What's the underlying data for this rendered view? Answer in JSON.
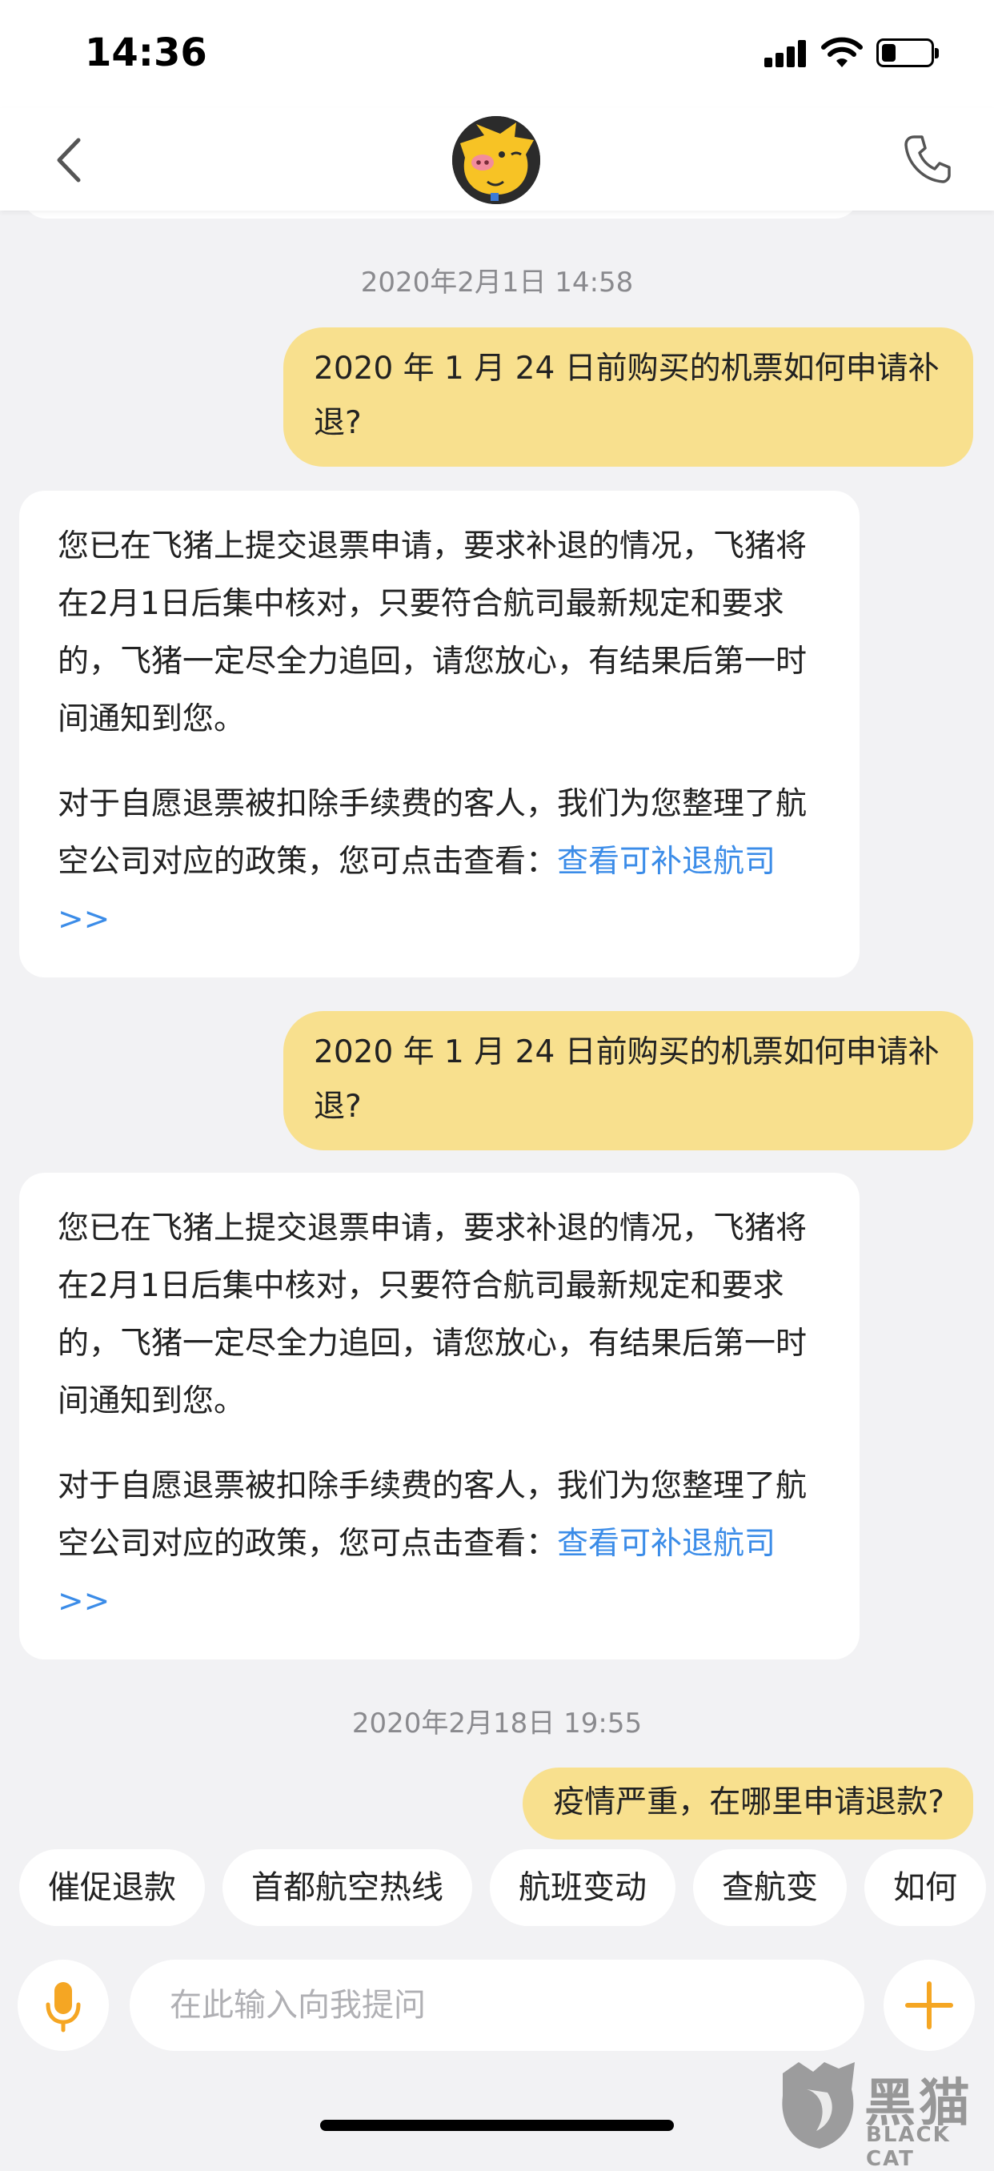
{
  "status_bar": {
    "time": "14:36",
    "battery_level": 0.3
  },
  "nav": {
    "avatar_icon": "fliggy-pig-icon",
    "back_icon": "back-chevron-icon",
    "call_icon": "phone-icon"
  },
  "messages": [
    {
      "type": "timestamp",
      "text": "2020年2月1日 14:58"
    },
    {
      "type": "user",
      "text": "2020 年 1 月 24 日前购买的机票如何申请补退?"
    },
    {
      "type": "bot",
      "p1": "您已在飞猪上提交退票申请，要求补退的情况，飞猪将在2月1日后集中核对，只要符合航司最新规定和要求的，飞猪一定尽全力追回，请您放心，有结果后第一时间通知到您。",
      "p2": "对于自愿退票被扣除手续费的客人，我们为您整理了航空公司对应的政策，您可点击查看：",
      "link": "查看可补退航司>>"
    },
    {
      "type": "user",
      "text": "2020 年 1 月 24 日前购买的机票如何申请补退?"
    },
    {
      "type": "bot",
      "p1": "您已在飞猪上提交退票申请，要求补退的情况，飞猪将在2月1日后集中核对，只要符合航司最新规定和要求的，飞猪一定尽全力追回，请您放心，有结果后第一时间通知到您。",
      "p2": "对于自愿退票被扣除手续费的客人，我们为您整理了航空公司对应的政策，您可点击查看：",
      "link": "查看可补退航司>>"
    },
    {
      "type": "timestamp",
      "text": "2020年2月18日 19:55"
    },
    {
      "type": "user",
      "text": "疫情严重，在哪里申请退款?"
    }
  ],
  "quick_replies": [
    "催促退款",
    "首都航空热线",
    "航班变动",
    "查航变",
    "如何"
  ],
  "input": {
    "placeholder": "在此输入向我提问",
    "mic_icon": "microphone-icon",
    "plus_icon": "plus-icon"
  },
  "watermark": {
    "cn": "黑猫",
    "en": "BLACK CAT"
  },
  "colors": {
    "user_bubble": "#f8e08e",
    "link": "#3b8ce8",
    "accent": "#f5a623",
    "background": "#f2f2f4"
  }
}
